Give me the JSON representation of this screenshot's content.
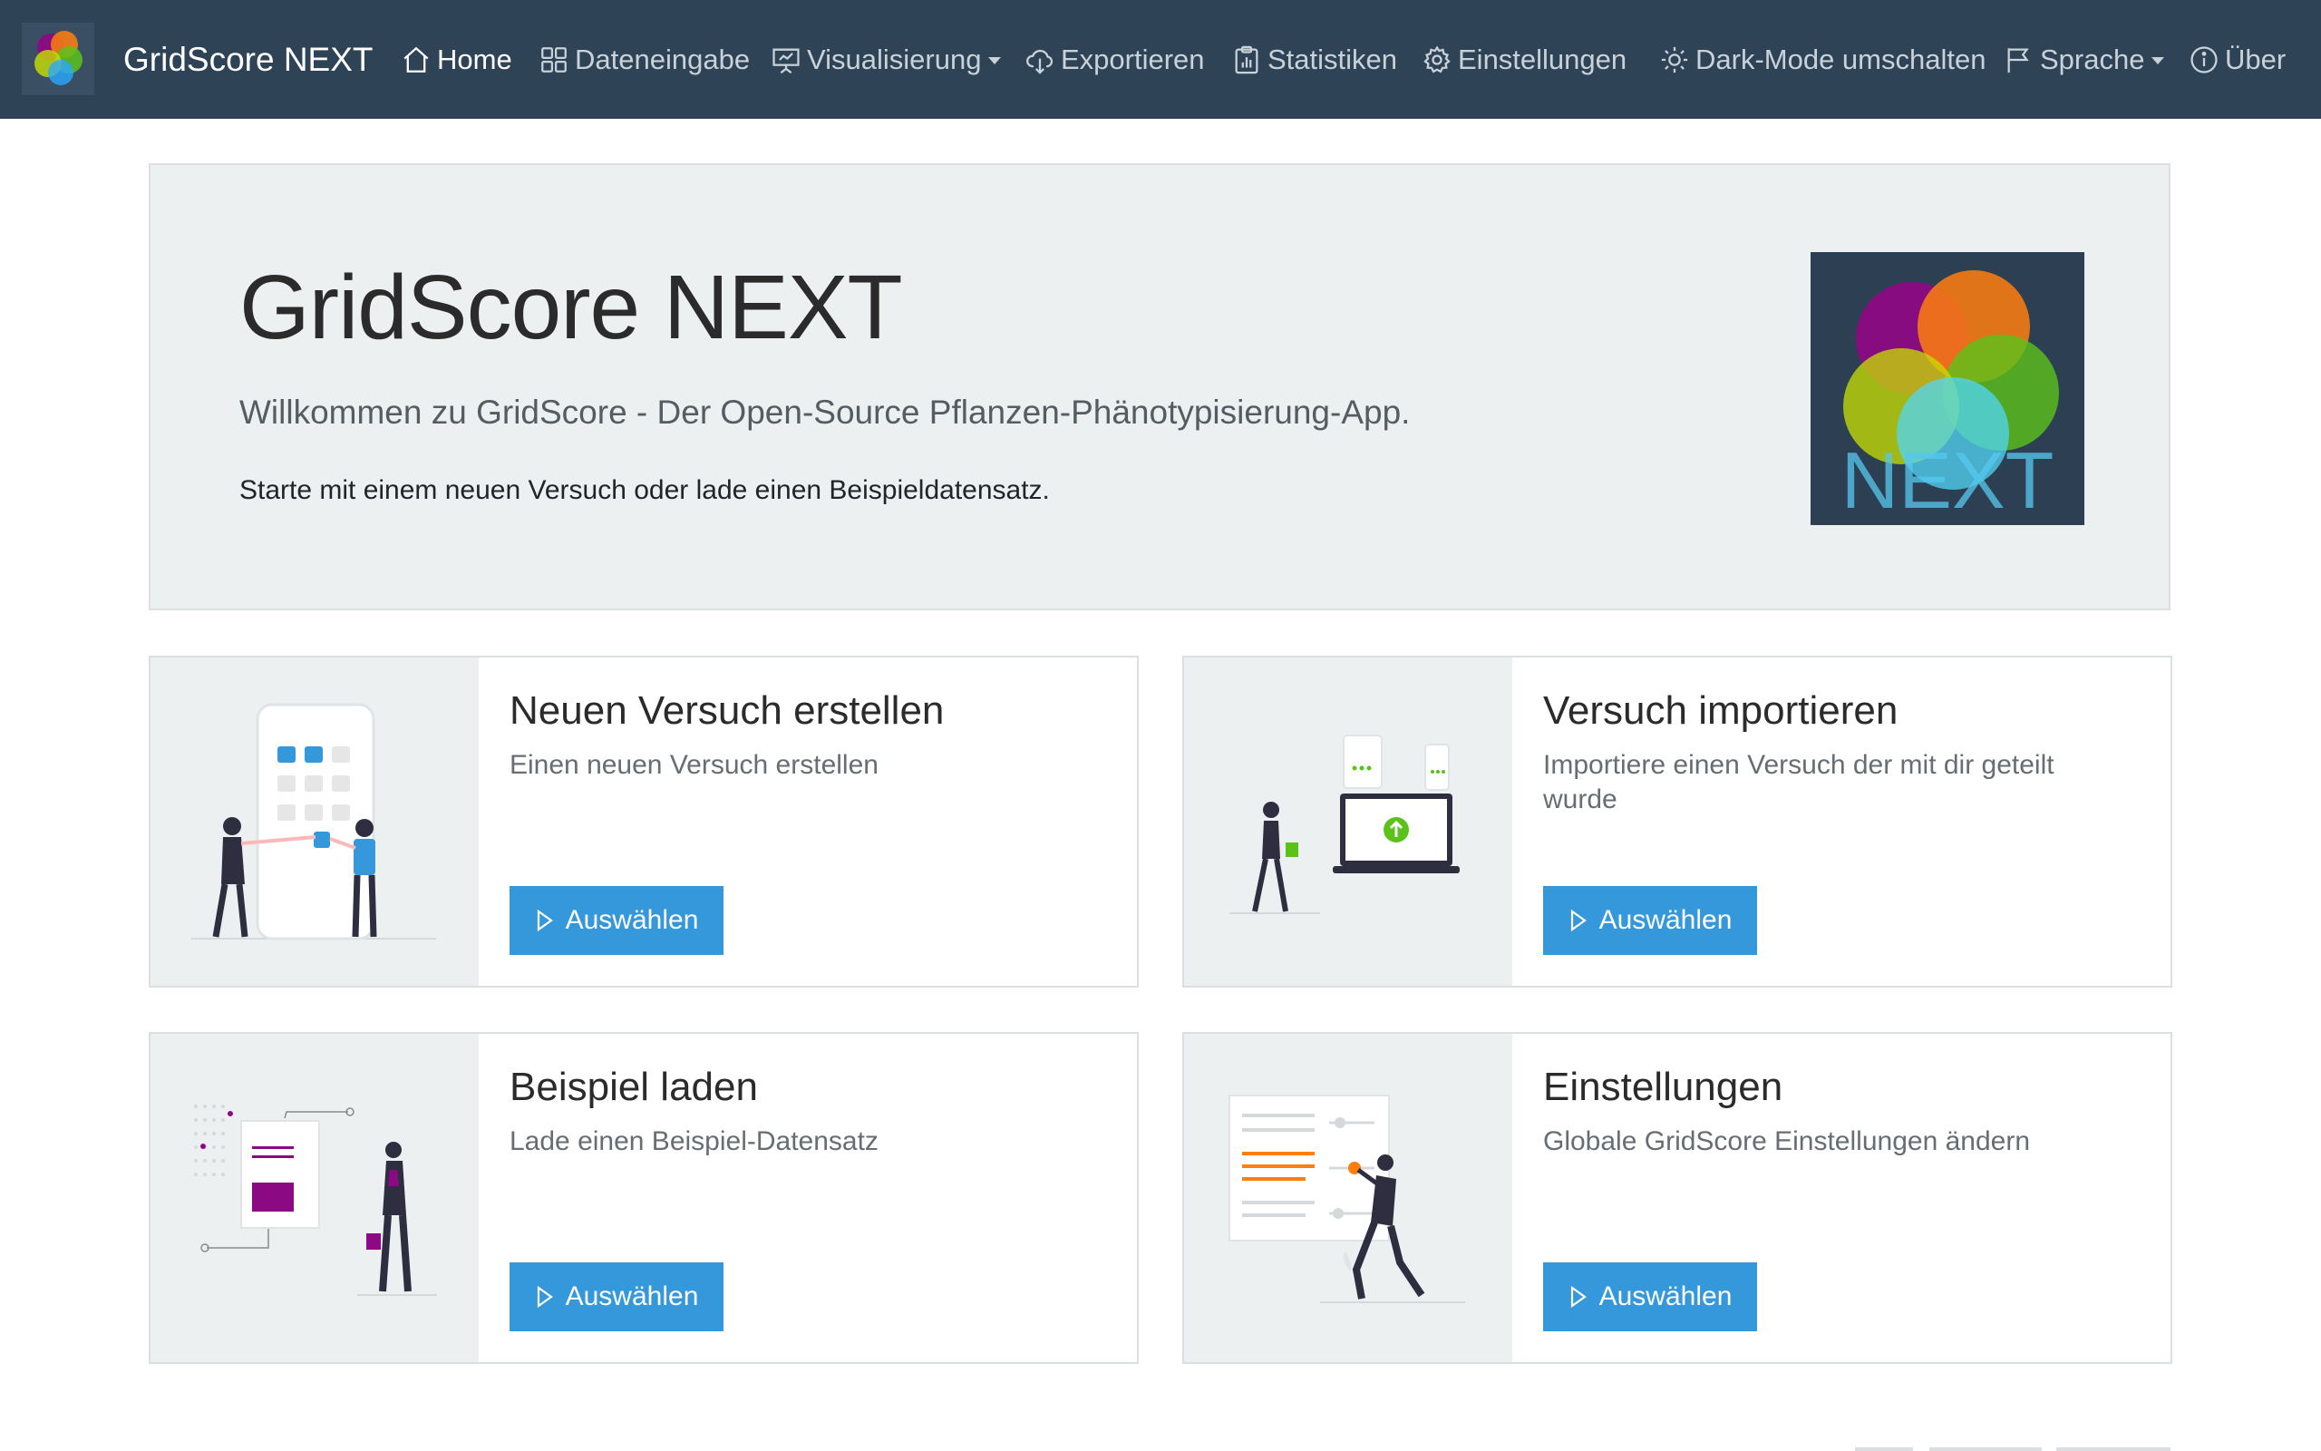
{
  "app": {
    "name": "GridScore NEXT",
    "logo_text": "NEXT"
  },
  "nav": {
    "home": "Home",
    "data_entry": "Dateneingabe",
    "visualization": "Visualisierung",
    "export": "Exportieren",
    "statistics": "Statistiken",
    "settings": "Einstellungen",
    "dark_mode": "Dark-Mode umschalten",
    "language": "Sprache",
    "about": "Über"
  },
  "jumbotron": {
    "title": "GridScore NEXT",
    "lead": "Willkommen zu GridScore - Der Open-Source Pflanzen-Phänotypisierung-App.",
    "text": "Starte mit einem neuen Versuch oder lade einen Beispieldatensatz."
  },
  "cards": [
    {
      "title": "Neuen Versuch erstellen",
      "text": "Einen neuen Versuch erstellen",
      "button": "Auswählen"
    },
    {
      "title": "Versuch importieren",
      "text": "Importiere einen Versuch der mit dir geteilt wurde",
      "button": "Auswählen"
    },
    {
      "title": "Beispiel laden",
      "text": "Lade einen Beispiel-Datensatz",
      "button": "Auswählen"
    },
    {
      "title": "Einstellungen",
      "text": "Globale GridScore Einstellungen ändern",
      "button": "Auswählen"
    }
  ],
  "colors": {
    "navbar": "#2f4356",
    "primary_button": "#3498db",
    "jumbotron_bg": "#ecf0f1",
    "logo_bg": "#2d4053",
    "accent_purple": "#8b0a83",
    "accent_orange": "#ff7f0e",
    "accent_green": "#5bc21a"
  }
}
